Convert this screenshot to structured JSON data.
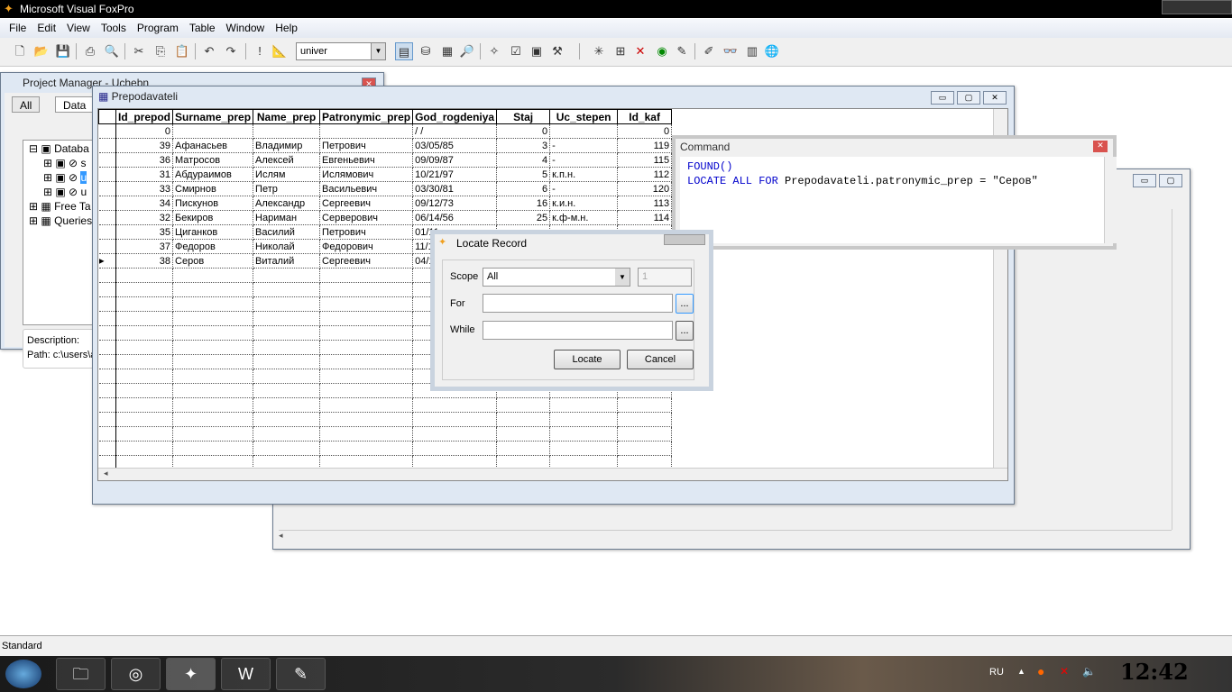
{
  "app": {
    "title": "Microsoft Visual FoxPro"
  },
  "menu": [
    "File",
    "Edit",
    "View",
    "Tools",
    "Program",
    "Table",
    "Window",
    "Help"
  ],
  "toolbar": {
    "database_combo": "univer"
  },
  "project_manager": {
    "title": "Project Manager - Uchebn",
    "tabs": [
      "All",
      "Data"
    ],
    "tree": [
      "Databa",
      "s",
      "u",
      "u",
      "Free Ta",
      "Queries"
    ],
    "description_label": "Description:",
    "path": "Path: c:\\users\\a"
  },
  "browse": {
    "title": "Prepodavateli",
    "columns": [
      "Id_prepod",
      "Surname_prep",
      "Name_prep",
      "Patronymic_prep",
      "God_rogdeniya",
      "Staj",
      "Uc_stepen",
      "Id_kaf"
    ],
    "rows": [
      [
        "0",
        "",
        "",
        "",
        "/ /",
        "0",
        "",
        "0"
      ],
      [
        "39",
        "Афанасьев",
        "Владимир",
        "Петрович",
        "03/05/85",
        "3",
        "-",
        "119"
      ],
      [
        "36",
        "Матросов",
        "Алексей",
        "Евгеньевич",
        "09/09/87",
        "4",
        "-",
        "115"
      ],
      [
        "31",
        "Абдураимов",
        "Ислям",
        "Ислямович",
        "10/21/97",
        "5",
        "к.п.н.",
        "112"
      ],
      [
        "33",
        "Смирнов",
        "Петр",
        "Васильевич",
        "03/30/81",
        "6",
        "-",
        "120"
      ],
      [
        "34",
        "Пискунов",
        "Александр",
        "Сергеевич",
        "09/12/73",
        "16",
        "к.и.н.",
        "113"
      ],
      [
        "32",
        "Бекиров",
        "Нариман",
        "Серверович",
        "06/14/56",
        "25",
        "к.ф-м.н.",
        "114"
      ],
      [
        "35",
        "Циганков",
        "Василий",
        "Петрович",
        "01/11",
        "",
        "",
        ""
      ],
      [
        "37",
        "Федоров",
        "Николай",
        "Федорович",
        "11/15",
        "",
        "",
        ""
      ],
      [
        "38",
        "Серов",
        "Виталий",
        "Сергеевич",
        "04/12",
        "",
        "",
        ""
      ]
    ],
    "current_row": 9
  },
  "command": {
    "title": "Command",
    "lines": [
      "FOUND()",
      "LOCATE ALL FOR Prepodavateli.patronymic_prep = \"Серов\""
    ]
  },
  "locate": {
    "title": "Locate Record",
    "scope_label": "Scope",
    "scope_value": "All",
    "scope_count": "1",
    "for_label": "For",
    "for_value": "",
    "while_label": "While",
    "while_value": "",
    "builder": "...",
    "locate_button": "Locate",
    "cancel_button": "Cancel"
  },
  "status": {
    "text": "Standard"
  },
  "tray": {
    "lang": "RU",
    "clock": "12:42"
  }
}
